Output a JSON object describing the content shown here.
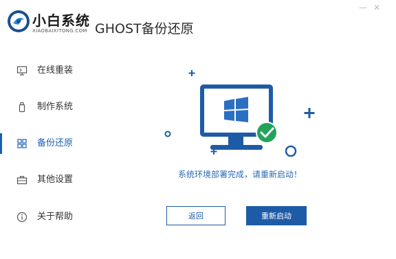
{
  "header": {
    "brand_name": "小白系统",
    "brand_url": "XIAOBAIXITONG.COM",
    "page_title": "GHOST备份还原",
    "minimize_glyph": "—",
    "close_glyph": "✕"
  },
  "sidebar": {
    "items": [
      {
        "label": "在线重装",
        "icon": "monitor-icon"
      },
      {
        "label": "制作系统",
        "icon": "usb-drive-icon"
      },
      {
        "label": "备份还原",
        "icon": "grid-backup-icon"
      },
      {
        "label": "其他设置",
        "icon": "toolbox-icon"
      },
      {
        "label": "关于帮助",
        "icon": "info-icon"
      }
    ],
    "active_index": 2
  },
  "main": {
    "status_message": "系统环境部署完成，请重新启动！",
    "back_button_label": "返回",
    "restart_button_label": "重新启动"
  },
  "colors": {
    "accent": "#1e5ba6",
    "status_text": "#2a6ab8",
    "check_green": "#22a35a"
  }
}
